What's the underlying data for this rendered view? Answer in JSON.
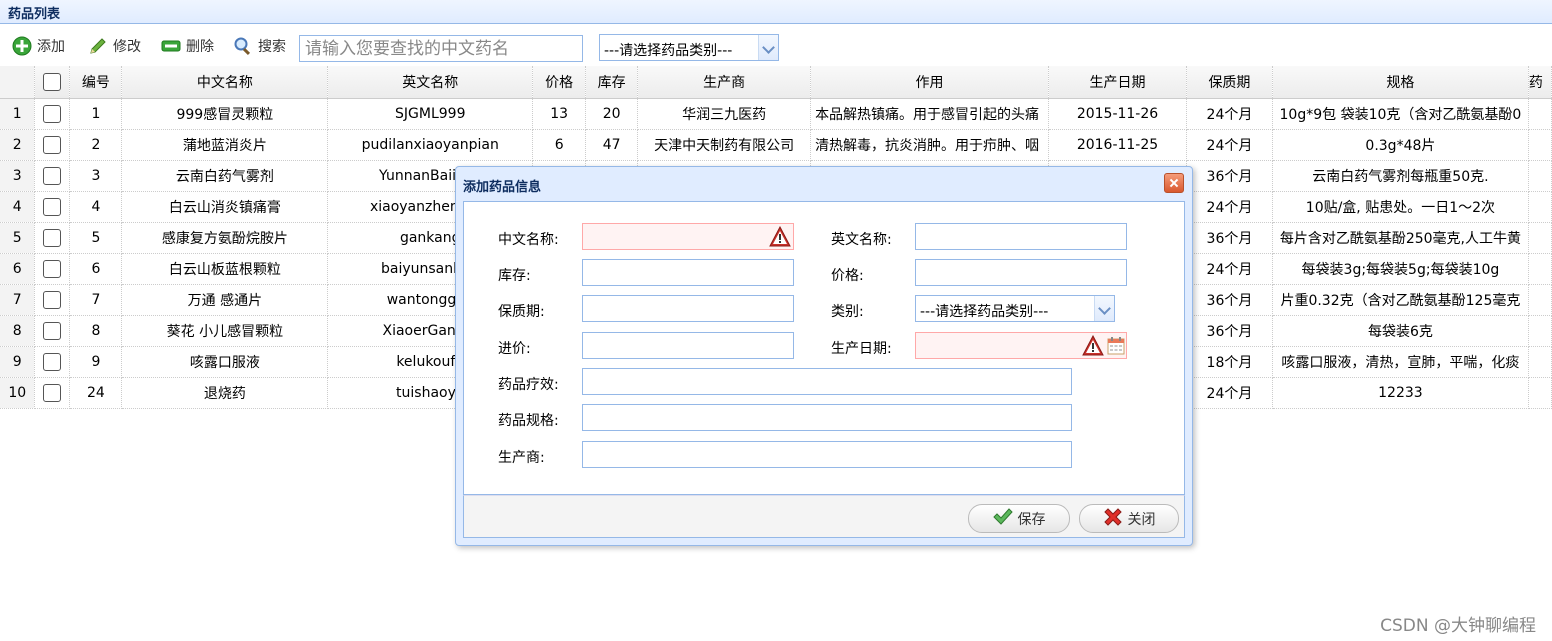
{
  "panel": {
    "title": "药品列表"
  },
  "toolbar": {
    "add_label": "添加",
    "edit_label": "修改",
    "delete_label": "删除",
    "search_label": "搜索",
    "search_placeholder": "请输入您要查找的中文药名",
    "category_select": "---请选择药品类别---"
  },
  "table": {
    "columns": [
      "编号",
      "中文名称",
      "英文名称",
      "价格",
      "库存",
      "生产商",
      "作用",
      "生产日期",
      "保质期",
      "规格",
      "药"
    ],
    "rows": [
      {
        "n": "1",
        "id": "1",
        "cn": "999感冒灵颗粒",
        "en": "SJGML999",
        "price": "13",
        "stock": "20",
        "maker": "华润三九医药",
        "effect": "本品解热镇痛。用于感冒引起的头痛",
        "date": "2015-11-26",
        "shelf": "24个月",
        "spec": "10g*9包 袋装10克（含对乙酰氨基酚0"
      },
      {
        "n": "2",
        "id": "2",
        "cn": "蒲地蓝消炎片",
        "en": "pudilanxiaoyanpian",
        "price": "6",
        "stock": "47",
        "maker": "天津中天制药有限公司",
        "effect": "清热解毒，抗炎消肿。用于疖肿、咽",
        "date": "2016-11-25",
        "shelf": "24个月",
        "spec": "0.3g*48片"
      },
      {
        "n": "3",
        "id": "3",
        "cn": "云南白药气雾剂",
        "en": "YunnanBaiiyao",
        "price": "",
        "stock": "",
        "maker": "",
        "effect": "",
        "date": "",
        "shelf": "36个月",
        "spec": "云南白药气雾剂每瓶重50克."
      },
      {
        "n": "4",
        "id": "4",
        "cn": "白云山消炎镇痛膏",
        "en": "xiaoyanzhentong",
        "price": "",
        "stock": "",
        "maker": "",
        "effect": "",
        "date": "",
        "shelf": "24个月",
        "spec": "10贴/盒, 贴患处。一日1～2次"
      },
      {
        "n": "5",
        "id": "5",
        "cn": "感康复方氨酚烷胺片",
        "en": "gankang",
        "price": "",
        "stock": "",
        "maker": "",
        "effect": "",
        "date": "",
        "shelf": "36个月",
        "spec": "每片含对乙酰氨基酚250毫克,人工牛黄"
      },
      {
        "n": "6",
        "id": "6",
        "cn": "白云山板蓝根颗粒",
        "en": "baiyunsanban",
        "price": "",
        "stock": "",
        "maker": "",
        "effect": "",
        "date": "",
        "shelf": "24个月",
        "spec": "每袋装3g;每袋装5g;每袋装10g"
      },
      {
        "n": "7",
        "id": "7",
        "cn": "万通 感通片",
        "en": "wantonggan",
        "price": "",
        "stock": "",
        "maker": "",
        "effect": "",
        "date": "",
        "shelf": "36个月",
        "spec": "片重0.32克（含对乙酰氨基酚125毫克"
      },
      {
        "n": "8",
        "id": "8",
        "cn": "葵花 小儿感冒颗粒",
        "en": "XiaoerGanma",
        "price": "",
        "stock": "",
        "maker": "",
        "effect": "",
        "date": "",
        "shelf": "36个月",
        "spec": "每袋装6克"
      },
      {
        "n": "9",
        "id": "9",
        "cn": "咳露口服液",
        "en": "kelukoufu",
        "price": "",
        "stock": "",
        "maker": "",
        "effect": "",
        "date": "",
        "shelf": "18个月",
        "spec": "咳露口服液，清热，宣肺，平喘，化痰"
      },
      {
        "n": "10",
        "id": "24",
        "cn": "退烧药",
        "en": "tuishaoya",
        "price": "",
        "stock": "",
        "maker": "",
        "effect": "",
        "date": "",
        "shelf": "24个月",
        "spec": "12233"
      }
    ]
  },
  "dialog": {
    "title": "添加药品信息",
    "cn_name_label": "中文名称:",
    "en_name_label": "英文名称:",
    "stock_label": "库存:",
    "price_label": "价格:",
    "shelf_label": "保质期:",
    "category_label": "类别:",
    "category_value": "---请选择药品类别---",
    "cost_label": "进价:",
    "date_label": "生产日期:",
    "effect_label": "药品疗效:",
    "spec_label": "药品规格:",
    "maker_label": "生产商:",
    "save_label": "保存",
    "close_label": "关闭"
  },
  "watermark": "CSDN @大钟聊编程"
}
